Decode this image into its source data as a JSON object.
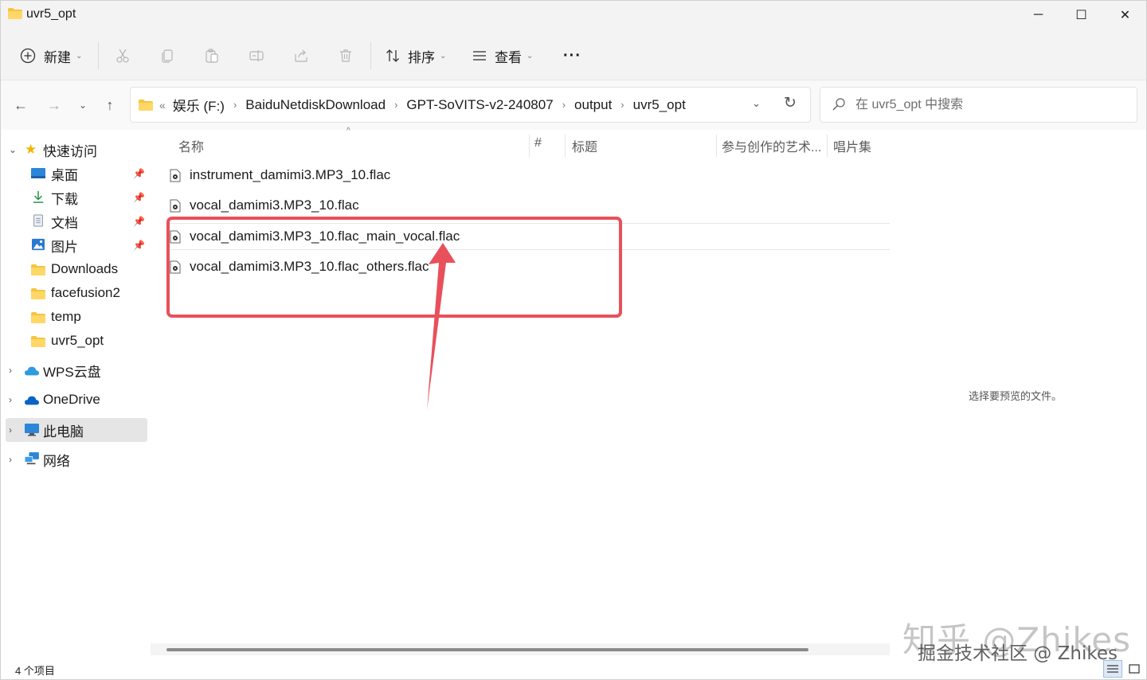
{
  "window": {
    "title": "uvr5_opt",
    "controls": {
      "minimize": "─",
      "maximize": "☐",
      "close": "✕"
    }
  },
  "toolbar": {
    "new_label": "新建",
    "sort_label": "排序",
    "view_label": "查看",
    "more_label": "···"
  },
  "nav": {
    "breadcrumbs": [
      "娱乐 (F:)",
      "BaiduNetdiskDownload",
      "GPT-SoVITS-v2-240807",
      "output",
      "uvr5_opt"
    ],
    "overflow": "«",
    "search_placeholder": "在 uvr5_opt 中搜索"
  },
  "sidebar": {
    "quick_access": "快速访问",
    "items": [
      {
        "label": "桌面",
        "pinned": true
      },
      {
        "label": "下载",
        "pinned": true
      },
      {
        "label": "文档",
        "pinned": true
      },
      {
        "label": "图片",
        "pinned": true
      },
      {
        "label": "Downloads",
        "pinned": false
      },
      {
        "label": "facefusion2",
        "pinned": false
      },
      {
        "label": "temp",
        "pinned": false
      },
      {
        "label": "uvr5_opt",
        "pinned": false
      }
    ],
    "wps": "WPS云盘",
    "onedrive": "OneDrive",
    "this_pc": "此电脑",
    "network": "网络"
  },
  "columns": {
    "name": "名称",
    "number": "#",
    "title": "标题",
    "artists": "参与创作的艺术...",
    "album": "唱片集"
  },
  "files": [
    "instrument_damimi3.MP3_10.flac",
    "vocal_damimi3.MP3_10.flac",
    "vocal_damimi3.MP3_10.flac_main_vocal.flac",
    "vocal_damimi3.MP3_10.flac_others.flac"
  ],
  "preview_pane": {
    "empty_text": "选择要预览的文件。"
  },
  "status": {
    "item_count": "4 个项目"
  },
  "watermark": {
    "line1": "知乎 @Zhikes",
    "line2": "掘金技术社区 @ Zhikes"
  },
  "colors": {
    "annotation": "#e8505b",
    "selected_bg": "#e5e5e5",
    "folder": "#f4c542"
  }
}
